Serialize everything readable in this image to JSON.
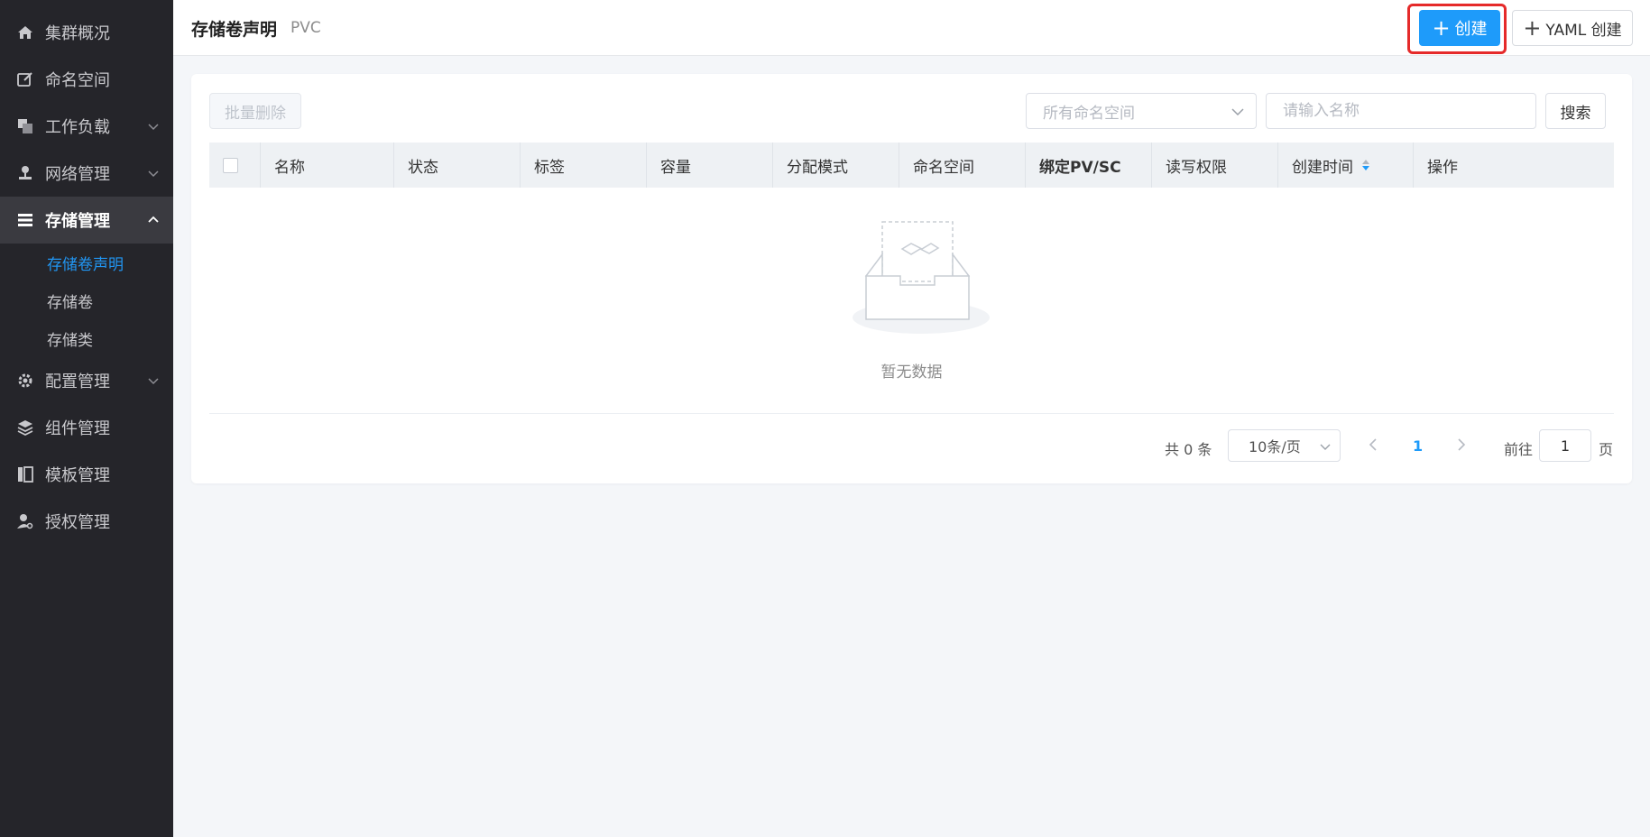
{
  "sidebar": {
    "items": [
      {
        "label": "集群概况",
        "icon": "home-icon"
      },
      {
        "label": "命名空间",
        "icon": "edit-icon"
      },
      {
        "label": "工作负载",
        "icon": "layers-icon"
      },
      {
        "label": "网络管理",
        "icon": "network-icon"
      },
      {
        "label": "存储管理",
        "icon": "storage-icon"
      },
      {
        "label": "配置管理",
        "icon": "gear-icon"
      },
      {
        "label": "组件管理",
        "icon": "stack-icon"
      },
      {
        "label": "模板管理",
        "icon": "template-icon"
      },
      {
        "label": "授权管理",
        "icon": "user-key-icon"
      }
    ],
    "storage_sub": [
      "存储卷声明",
      "存储卷",
      "存储类"
    ]
  },
  "header": {
    "title": "存储卷声明",
    "subtitle": "PVC",
    "create_label": "创建",
    "yaml_create_label": "YAML 创建"
  },
  "toolbar": {
    "batch_delete_label": "批量删除",
    "namespace_placeholder": "所有命名空间",
    "name_placeholder": "请输入名称",
    "search_label": "搜索"
  },
  "table": {
    "columns": [
      "名称",
      "状态",
      "标签",
      "容量",
      "分配模式",
      "命名空间",
      "绑定PV/SC",
      "读写权限",
      "创建时间",
      "操作"
    ],
    "empty_text": "暂无数据"
  },
  "pagination": {
    "total_text": "共 0 条",
    "page_size": "10条/页",
    "current_page": "1",
    "goto_label": "前往",
    "goto_value": "1",
    "page_suffix": "页"
  },
  "colors": {
    "accent": "#1e9bfa",
    "sidebar_bg": "#25252a",
    "highlight": "#e52a2a"
  }
}
